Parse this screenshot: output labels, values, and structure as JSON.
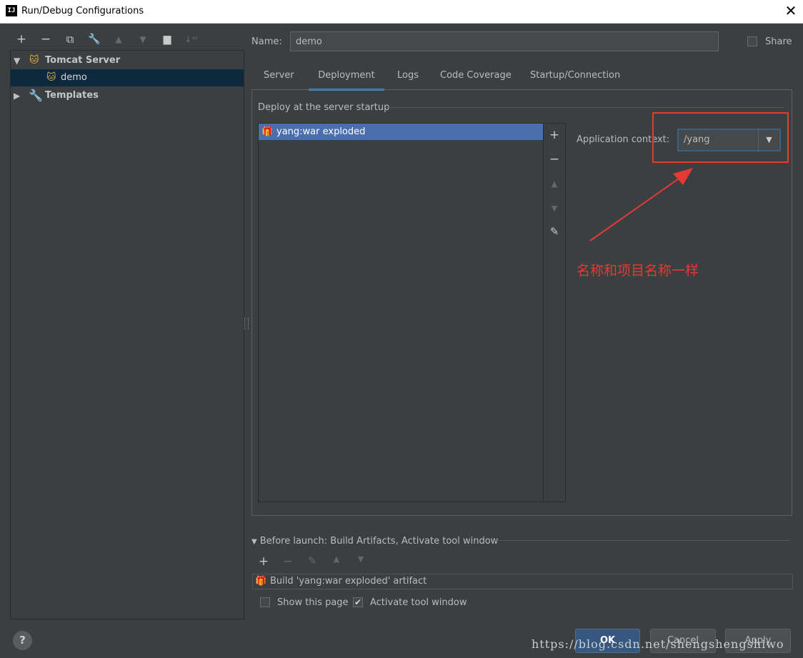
{
  "window": {
    "title": "Run/Debug Configurations",
    "app_icon": "IJ",
    "close": "✕"
  },
  "toolbar": {
    "add": "+",
    "remove": "−",
    "copy": "⧉",
    "edit": "🔧",
    "up": "▲",
    "down": "▼",
    "folder": "▆",
    "sort": "↓ᵃᶻ"
  },
  "tree": {
    "items": [
      {
        "label": "Tomcat Server",
        "expanded": true
      },
      {
        "label": "demo",
        "selected": true
      },
      {
        "label": "Templates",
        "expanded": false
      }
    ]
  },
  "name": {
    "label": "Name:",
    "value": "demo"
  },
  "share": {
    "label": "Share",
    "checked": false
  },
  "tabs": [
    {
      "label": "Server"
    },
    {
      "label": "Deployment",
      "active": true
    },
    {
      "label": "Logs"
    },
    {
      "label": "Code Coverage"
    },
    {
      "label": "Startup/Connection"
    }
  ],
  "deploy": {
    "section_title": "Deploy at the server startup",
    "artifacts": [
      "yang:war exploded"
    ],
    "app_context_label": "Application context:",
    "app_context_value": "/yang"
  },
  "annotation": {
    "text": "名称和项目名称一样",
    "color": "#e53935"
  },
  "before_launch": {
    "title": "Before launch: Build Artifacts, Activate tool window",
    "items": [
      "Build 'yang:war exploded' artifact"
    ]
  },
  "options": {
    "show_page": {
      "label": "Show this page",
      "checked": false
    },
    "activate_tool": {
      "label": "Activate tool window",
      "checked": true
    }
  },
  "buttons": {
    "help": "?",
    "ok": "OK",
    "cancel": "Cancel",
    "apply": "Apply"
  },
  "watermark": "https://blog.csdn.net/shengshengshiwo"
}
